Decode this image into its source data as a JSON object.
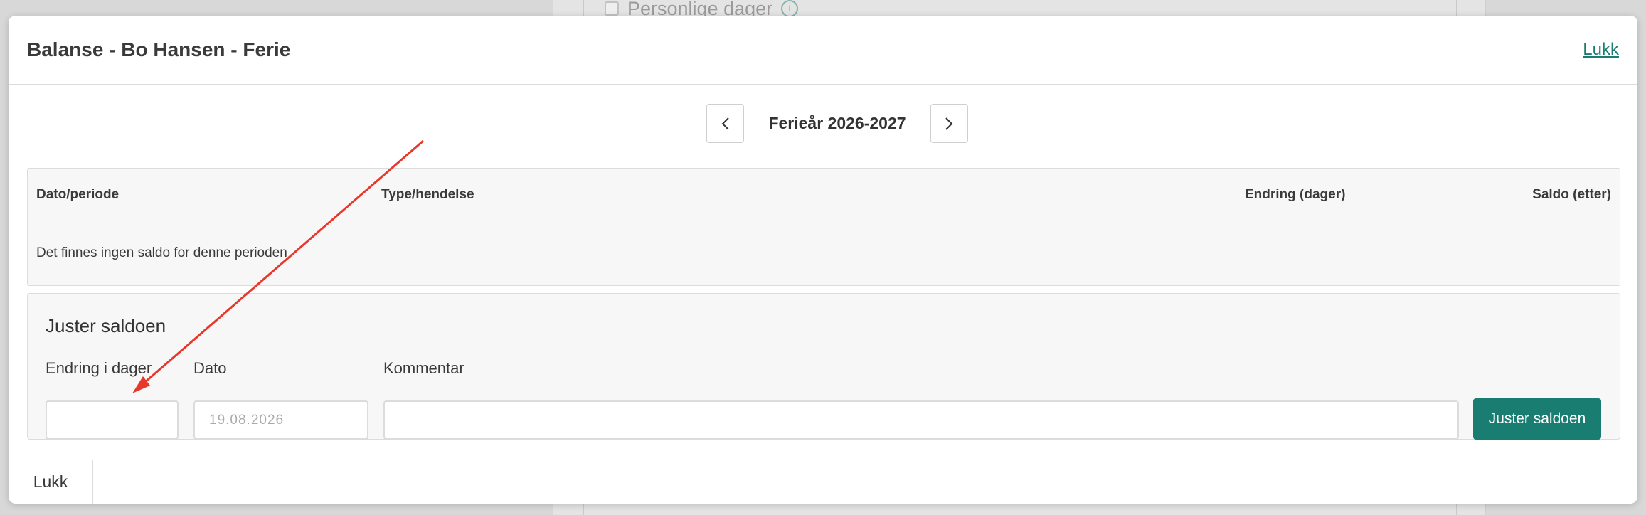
{
  "background": {
    "checkbox_label": "Personlige dager",
    "info_icon": "info-icon"
  },
  "modal": {
    "title": "Balanse - Bo Hansen - Ferie",
    "close_link": "Lukk",
    "period": {
      "label": "Ferieår 2026-2027",
      "prev_icon": "chevron-left-icon",
      "next_icon": "chevron-right-icon"
    },
    "table": {
      "columns": [
        "Dato/periode",
        "Type/hendelse",
        "Endring (dager)",
        "Saldo (etter)"
      ],
      "empty_message": "Det finnes ingen saldo for denne perioden"
    },
    "adjust": {
      "title": "Juster saldoen",
      "change_label": "Endring i dager",
      "change_value": "",
      "date_label": "Dato",
      "date_placeholder": "19.08.2026",
      "comment_label": "Kommentar",
      "comment_value": "",
      "submit_label": "Juster saldoen"
    },
    "footer": {
      "close_label": "Lukk"
    }
  },
  "colors": {
    "accent": "#1a7d72",
    "annotation_arrow": "#e8382b"
  }
}
